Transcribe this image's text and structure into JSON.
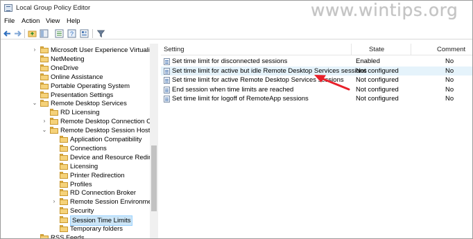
{
  "window": {
    "title": "Local Group Policy Editor",
    "watermark": "www.wintips.org"
  },
  "menu": [
    "File",
    "Action",
    "View",
    "Help"
  ],
  "toolbar": {
    "icons": [
      "back-arrow-icon",
      "forward-arrow-icon",
      "up-folder-icon",
      "show-hide-tree-icon",
      "export-list-icon",
      "help-icon",
      "properties-icon",
      "filter-icon"
    ]
  },
  "tree": {
    "items": [
      {
        "label": "Microsoft User Experience Virtualization",
        "expander": "›"
      },
      {
        "label": "NetMeeting",
        "expander": ""
      },
      {
        "label": "OneDrive",
        "expander": ""
      },
      {
        "label": "Online Assistance",
        "expander": ""
      },
      {
        "label": "Portable Operating System",
        "expander": ""
      },
      {
        "label": "Presentation Settings",
        "expander": ""
      },
      {
        "label": "Remote Desktop Services",
        "expander": "⌄"
      },
      {
        "label": "RD Licensing",
        "expander": ""
      },
      {
        "label": "Remote Desktop Connection Client",
        "expander": "›"
      },
      {
        "label": "Remote Desktop Session Host",
        "expander": "⌄"
      },
      {
        "label": "Application Compatibility",
        "expander": ""
      },
      {
        "label": "Connections",
        "expander": ""
      },
      {
        "label": "Device and Resource Redirection",
        "expander": ""
      },
      {
        "label": "Licensing",
        "expander": ""
      },
      {
        "label": "Printer Redirection",
        "expander": ""
      },
      {
        "label": "Profiles",
        "expander": ""
      },
      {
        "label": "RD Connection Broker",
        "expander": ""
      },
      {
        "label": "Remote Session Environment",
        "expander": "›"
      },
      {
        "label": "Security",
        "expander": ""
      },
      {
        "label": "Session Time Limits",
        "expander": ""
      },
      {
        "label": "Temporary folders",
        "expander": ""
      },
      {
        "label": "RSS Feeds",
        "expander": ""
      }
    ]
  },
  "list": {
    "headers": {
      "setting": "Setting",
      "state": "State",
      "comment": "Comment"
    },
    "rows": [
      {
        "setting": "Set time limit for disconnected sessions",
        "state": "Enabled",
        "comment": "No"
      },
      {
        "setting": "Set time limit for active but idle Remote Desktop Services sessions",
        "state": "Not configured",
        "comment": "No"
      },
      {
        "setting": "Set time limit for active Remote Desktop Services sessions",
        "state": "Not configured",
        "comment": "No"
      },
      {
        "setting": "End session when time limits are reached",
        "state": "Not configured",
        "comment": "No"
      },
      {
        "setting": "Set time limit for logoff of RemoteApp sessions",
        "state": "Not configured",
        "comment": "No"
      }
    ]
  },
  "colors": {
    "annotation_arrow": "#e8202a",
    "selection": "#cde6f7",
    "hover_row": "#e5f3fb"
  }
}
